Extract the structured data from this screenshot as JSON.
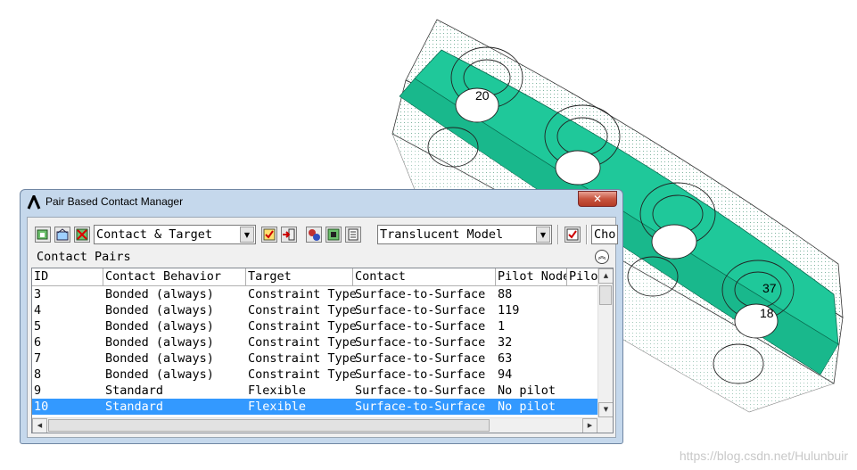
{
  "window": {
    "title": "Pair Based Contact Manager",
    "close_glyph": "✕"
  },
  "toolbar": {
    "filter_value": "Contact & Target",
    "display_value": "Translucent Model",
    "choice_value": "Cho"
  },
  "section": {
    "label": "Contact Pairs"
  },
  "table": {
    "columns": [
      "ID",
      "Contact Behavior",
      "Target",
      "Contact",
      "Pilot Node",
      "Pilo"
    ],
    "rows": [
      [
        "3",
        "Bonded (always)",
        "Constraint Type",
        "Surface-to-Surface",
        "88"
      ],
      [
        "4",
        "Bonded (always)",
        "Constraint Type",
        "Surface-to-Surface",
        "119"
      ],
      [
        "5",
        "Bonded (always)",
        "Constraint Type",
        "Surface-to-Surface",
        "1"
      ],
      [
        "6",
        "Bonded (always)",
        "Constraint Type",
        "Surface-to-Surface",
        "32"
      ],
      [
        "7",
        "Bonded (always)",
        "Constraint Type",
        "Surface-to-Surface",
        "63"
      ],
      [
        "8",
        "Bonded (always)",
        "Constraint Type",
        "Surface-to-Surface",
        "94"
      ],
      [
        "9",
        "Standard",
        "Flexible",
        "Surface-to-Surface",
        "No pilot"
      ],
      [
        "10",
        "Standard",
        "Flexible",
        "Surface-to-Surface",
        "No pilot"
      ]
    ],
    "selected_row": 7
  },
  "model": {
    "labels": [
      "20",
      "37",
      "18"
    ],
    "surface_color": "#1fc89a"
  },
  "watermark": "https://blog.csdn.net/Hulunbuir",
  "colors": {
    "selection": "#3399ff",
    "title_bar": "#c5d8ec"
  }
}
